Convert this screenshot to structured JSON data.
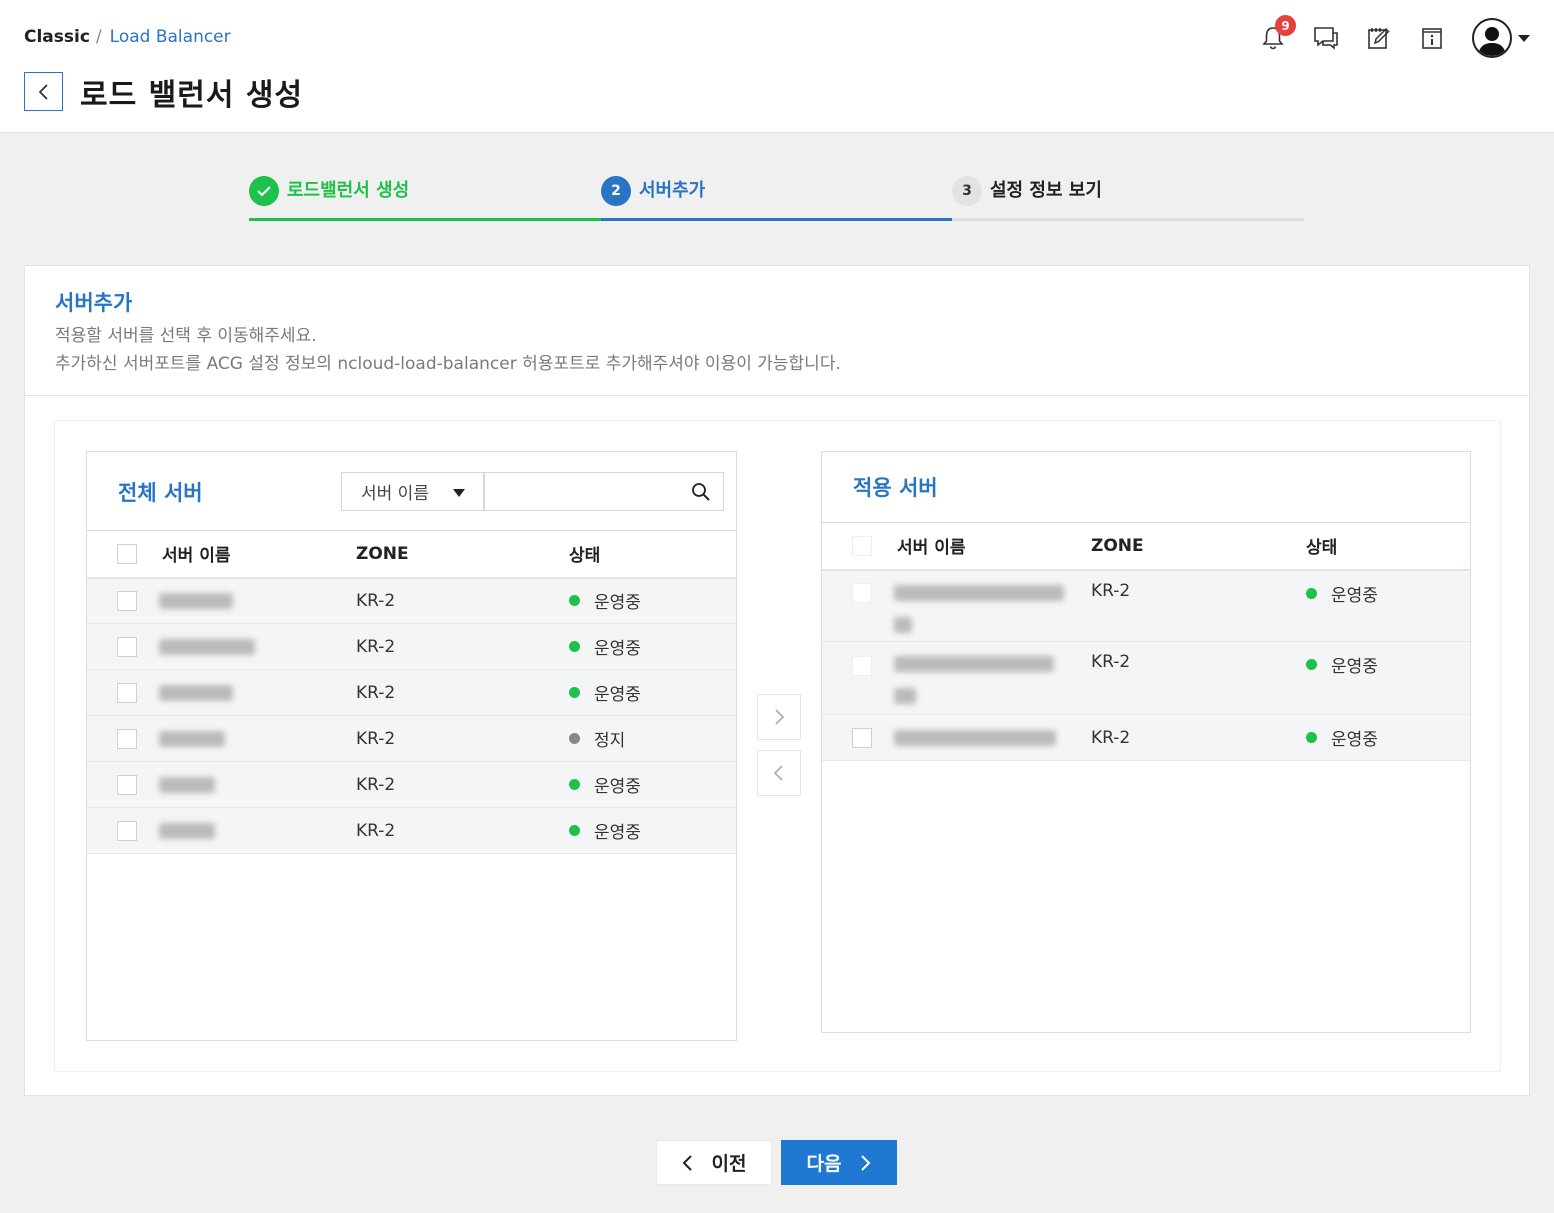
{
  "breadcrumb": {
    "root": "Classic",
    "separator": "/",
    "current": "Load Balancer"
  },
  "page_title": "로드 밸런서 생성",
  "notifications": {
    "count": "9"
  },
  "icons": {
    "back": "chevron-left-icon",
    "bell": "bell-icon",
    "chat": "chat-icon",
    "memo": "memo-edit-icon",
    "info": "info-book-icon",
    "user": "user-avatar-icon"
  },
  "steps": [
    {
      "num": "✓",
      "label": "로드밸런서 생성",
      "state": "done",
      "color": "#1ec14a"
    },
    {
      "num": "2",
      "label": "서버추가",
      "state": "active",
      "color": "#2a74c4"
    },
    {
      "num": "3",
      "label": "설정 정보 보기",
      "state": "pending",
      "color": "#222222"
    }
  ],
  "section": {
    "title": "서버추가",
    "desc1": "적용할 서버를 선택 후 이동해주세요.",
    "desc2": "추가하신 서버포트를 ACG 설정 정보의 ncloud-load-balancer 허용포트로 추가해주셔야 이용이 가능합니다."
  },
  "all_servers": {
    "title": "전체 서버",
    "filter": {
      "selected": "서버 이름"
    },
    "search": {
      "value": "",
      "placeholder": ""
    },
    "columns": [
      "서버 이름",
      "ZONE",
      "상태"
    ],
    "rows": [
      {
        "zone": "KR-2",
        "status": "운영중",
        "status_color": "#1ec14a"
      },
      {
        "zone": "KR-2",
        "status": "운영중",
        "status_color": "#1ec14a"
      },
      {
        "zone": "KR-2",
        "status": "운영중",
        "status_color": "#1ec14a"
      },
      {
        "zone": "KR-2",
        "status": "정지",
        "status_color": "#888888"
      },
      {
        "zone": "KR-2",
        "status": "운영중",
        "status_color": "#1ec14a"
      },
      {
        "zone": "KR-2",
        "status": "운영중",
        "status_color": "#1ec14a"
      }
    ]
  },
  "applied_servers": {
    "title": "적용 서버",
    "columns": [
      "서버 이름",
      "ZONE",
      "상태"
    ],
    "rows": [
      {
        "zone": "KR-2",
        "status": "운영중",
        "status_color": "#1ec14a"
      },
      {
        "zone": "KR-2",
        "status": "운영중",
        "status_color": "#1ec14a"
      },
      {
        "zone": "KR-2",
        "status": "운영중",
        "status_color": "#1ec14a"
      }
    ]
  },
  "move_buttons": {
    "add": "chevron-right-icon",
    "remove": "chevron-left-icon"
  },
  "footer": {
    "prev_label": "이전",
    "next_label": "다음"
  },
  "colors": {
    "accent": "#2a74c4",
    "primary_button": "#1f78d1",
    "success": "#1ec14a",
    "badge": "#e8403c"
  }
}
